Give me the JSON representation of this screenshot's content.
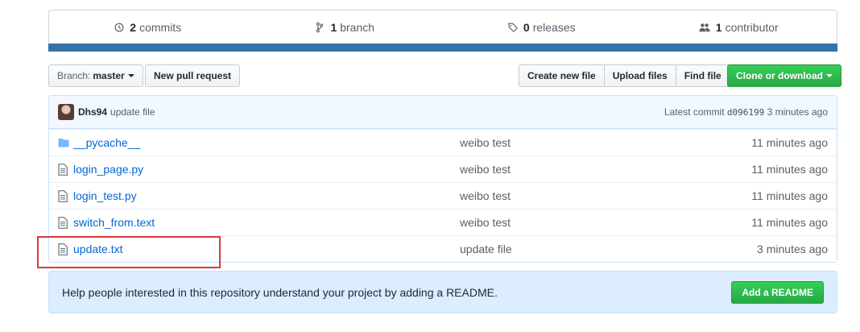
{
  "summary": {
    "commits": {
      "num": "2",
      "label": "commits"
    },
    "branch": {
      "num": "1",
      "label": "branch"
    },
    "releases": {
      "num": "0",
      "label": "releases"
    },
    "contributors": {
      "num": "1",
      "label": "contributor"
    },
    "language_color": "#3572a5"
  },
  "toolbar": {
    "branch_prefix": "Branch:",
    "branch_name": "master",
    "new_pr": "New pull request",
    "create_file": "Create new file",
    "upload_files": "Upload files",
    "find_file": "Find file",
    "clone": "Clone or download"
  },
  "commit": {
    "author": "Dhs94",
    "message": "update file",
    "latest_label": "Latest commit",
    "sha": "d096199",
    "age": "3 minutes ago"
  },
  "files": [
    {
      "icon": "folder-icon",
      "name": "__pycache__",
      "message": "weibo test",
      "age": "11 minutes ago"
    },
    {
      "icon": "file-icon",
      "name": "login_page.py",
      "message": "weibo test",
      "age": "11 minutes ago"
    },
    {
      "icon": "file-icon",
      "name": "login_test.py",
      "message": "weibo test",
      "age": "11 minutes ago"
    },
    {
      "icon": "file-icon",
      "name": "switch_from.text",
      "message": "weibo test",
      "age": "11 minutes ago"
    },
    {
      "icon": "file-icon",
      "name": "update.txt",
      "message": "update file",
      "age": "3 minutes ago"
    }
  ],
  "readme": {
    "text": "Help people interested in this repository understand your project by adding a README.",
    "button": "Add a README"
  },
  "colors": {
    "accent_green": "#28a745",
    "link_blue": "#0366d6",
    "highlight_red": "#d9393a"
  }
}
